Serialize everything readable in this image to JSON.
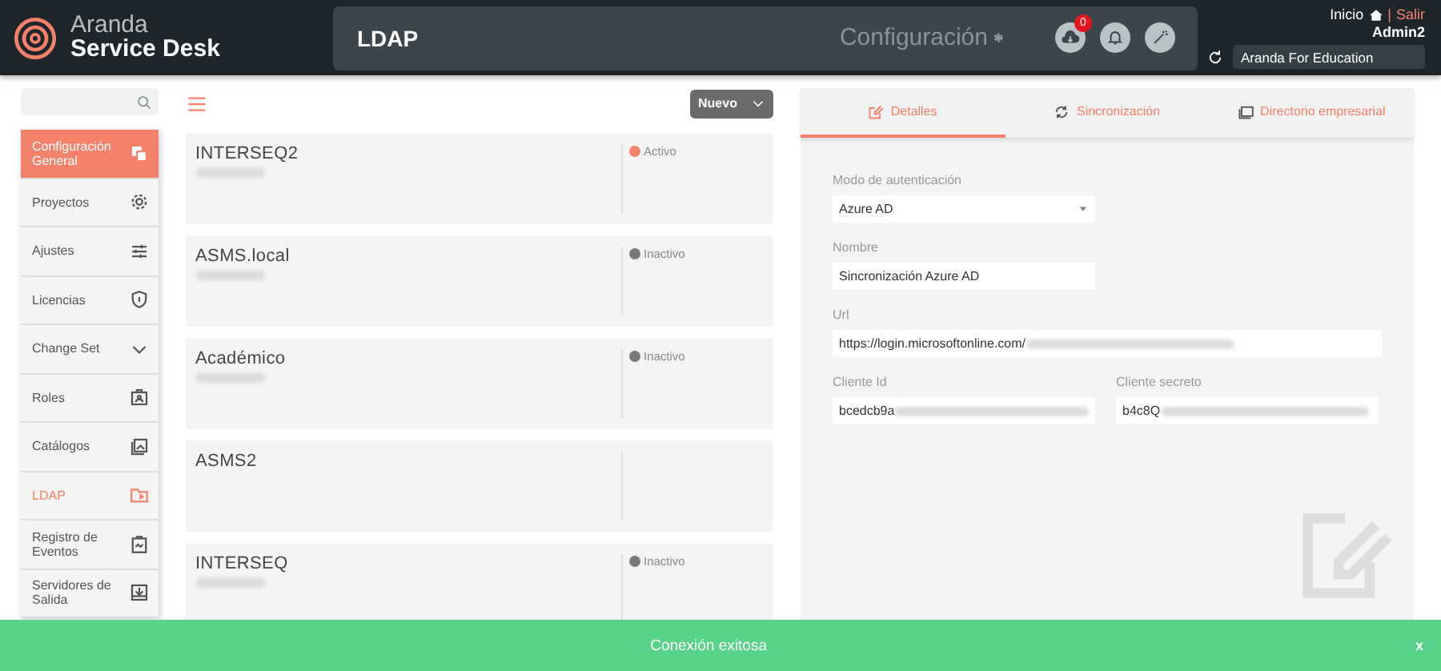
{
  "header": {
    "brand_top": "Aranda",
    "brand_bottom": "Service Desk",
    "page_title": "LDAP",
    "section": "Configuración",
    "notification_count": "0",
    "home_link": "Inicio",
    "separator": "|",
    "logout_link": "Salir",
    "user": "Admin2",
    "workspace": "Aranda For Education"
  },
  "sidebar": {
    "items": [
      {
        "label": "Configuración General",
        "selected": true,
        "current": false,
        "kind": "link"
      },
      {
        "label": "Proyectos",
        "selected": false,
        "current": false,
        "kind": "link"
      },
      {
        "label": "Ajustes",
        "selected": false,
        "current": false,
        "kind": "link"
      },
      {
        "label": "Licencias",
        "selected": false,
        "current": false,
        "kind": "link"
      },
      {
        "label": "Change Set",
        "selected": false,
        "current": false,
        "kind": "group"
      },
      {
        "label": "Roles",
        "selected": false,
        "current": false,
        "kind": "link"
      },
      {
        "label": "Catálogos",
        "selected": false,
        "current": false,
        "kind": "link"
      },
      {
        "label": "LDAP",
        "selected": false,
        "current": true,
        "kind": "link"
      },
      {
        "label": "Registro de Eventos",
        "selected": false,
        "current": false,
        "kind": "link"
      },
      {
        "label": "Servidores de Salida",
        "selected": false,
        "current": false,
        "kind": "link"
      }
    ]
  },
  "records": {
    "new_button": "Nuevo",
    "items": [
      {
        "name": "INTERSEQ2",
        "address_hidden": true,
        "status": "Activo",
        "color": "#f4826a"
      },
      {
        "name": "ASMS.local",
        "address_hidden": true,
        "status": "Inactivo",
        "color": "#7a7a7a"
      },
      {
        "name": "Académico",
        "address_hidden": true,
        "status": "Inactivo",
        "color": "#7a7a7a"
      },
      {
        "name": "ASMS2",
        "address_hidden": false
      },
      {
        "name": "INTERSEQ",
        "address_hidden": true,
        "status": "Inactivo",
        "color": "#7a7a7a"
      }
    ]
  },
  "detail": {
    "tabs": [
      {
        "label": "Detalles",
        "selected": true
      },
      {
        "label": "Sincronización",
        "selected": false
      },
      {
        "label": "Directorio empresarial",
        "selected": false
      }
    ],
    "auth_mode": {
      "label": "Modo de autenticación",
      "value": "Azure AD"
    },
    "name": {
      "label": "Nombre",
      "value": "Sincronización Azure AD"
    },
    "url": {
      "label": "Url",
      "value": "https://login.microsoftonline.com/",
      "hidden_rest": true
    },
    "client_id": {
      "label": "Cliente Id",
      "value": "bcedcb9a",
      "hidden_rest": true
    },
    "client_secret": {
      "label": "Cliente secreto",
      "value": "b4c8Q",
      "hidden_rest": true
    }
  },
  "toast": {
    "message": "Conexión exitosa",
    "close": "x"
  }
}
